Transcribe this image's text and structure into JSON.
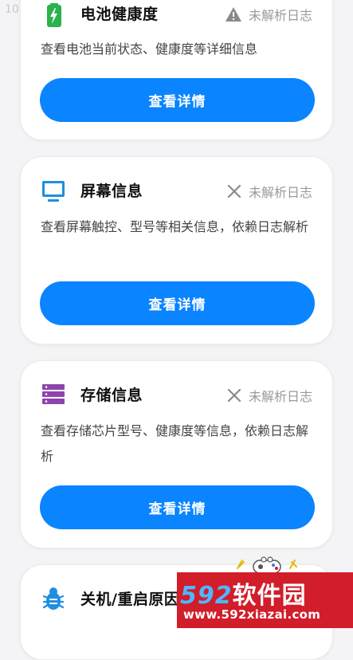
{
  "top_ghost_text": "10",
  "cards": [
    {
      "title": "电池健康度",
      "icon": "battery-charging-icon",
      "icon_color": "#2bb24c",
      "status_icon": "warning-icon",
      "status": "未解析日志",
      "description": "查看电池当前状态、健康度等详细信息",
      "button": "查看详情"
    },
    {
      "title": "屏幕信息",
      "icon": "monitor-icon",
      "icon_color": "#1e8fe1",
      "status_icon": "close-icon",
      "status": "未解析日志",
      "description": "查看屏幕触控、型号等相关信息，依赖日志解析",
      "button": "查看详情"
    },
    {
      "title": "存储信息",
      "icon": "storage-icon",
      "icon_color": "#8e44ad",
      "status_icon": "close-icon",
      "status": "未解析日志",
      "description": "查看存储芯片型号、健康度等信息，依赖日志解析",
      "button": "查看详情"
    },
    {
      "title": "关机/重启原因",
      "icon": "bug-icon",
      "icon_color": "#1e8fe1"
    }
  ],
  "colors": {
    "accent": "#0a84ff",
    "background": "#f4f4f6",
    "status_gray": "#9a9a9a"
  },
  "watermark": {
    "logo_num": "592",
    "logo_text": "软件园",
    "url": "www.592xiazai.com"
  }
}
